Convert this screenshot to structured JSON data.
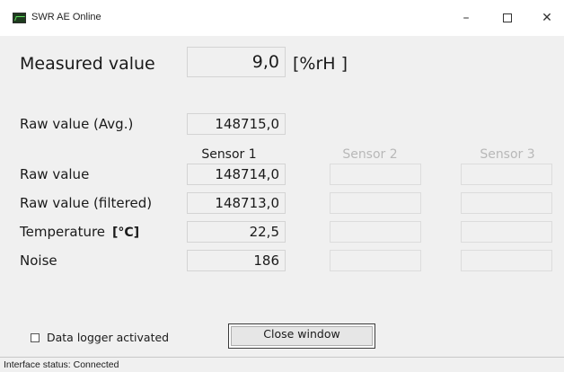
{
  "window": {
    "title": "SWR AE Online",
    "minimize_glyph": "–",
    "close_glyph": "✕"
  },
  "measured": {
    "label": "Measured value",
    "value": "9,0",
    "unit": "[%rH   ]"
  },
  "raw_avg": {
    "label": "Raw value (Avg.)",
    "value": "148715,0"
  },
  "sensors": {
    "headers": [
      "Sensor 1",
      "Sensor 2",
      "Sensor 3"
    ],
    "rows": [
      {
        "label": "Raw value",
        "unit": "",
        "values": [
          "148714,0",
          "",
          ""
        ]
      },
      {
        "label": "Raw value (filtered)",
        "unit": "",
        "values": [
          "148713,0",
          "",
          ""
        ]
      },
      {
        "label": "Temperature",
        "unit": "[°C]",
        "values": [
          "22,5",
          "",
          ""
        ]
      },
      {
        "label": "Noise",
        "unit": "",
        "values": [
          "186",
          "",
          ""
        ]
      }
    ]
  },
  "data_logger": {
    "label": "Data logger activated",
    "checked": false
  },
  "close_button": {
    "label": "Close window"
  },
  "status": {
    "text": "Interface status: Connected"
  },
  "colors": {
    "window_bg": "#f0f0f0",
    "titlebar_bg": "#ffffff",
    "disabled_text": "#b8b8b8"
  }
}
